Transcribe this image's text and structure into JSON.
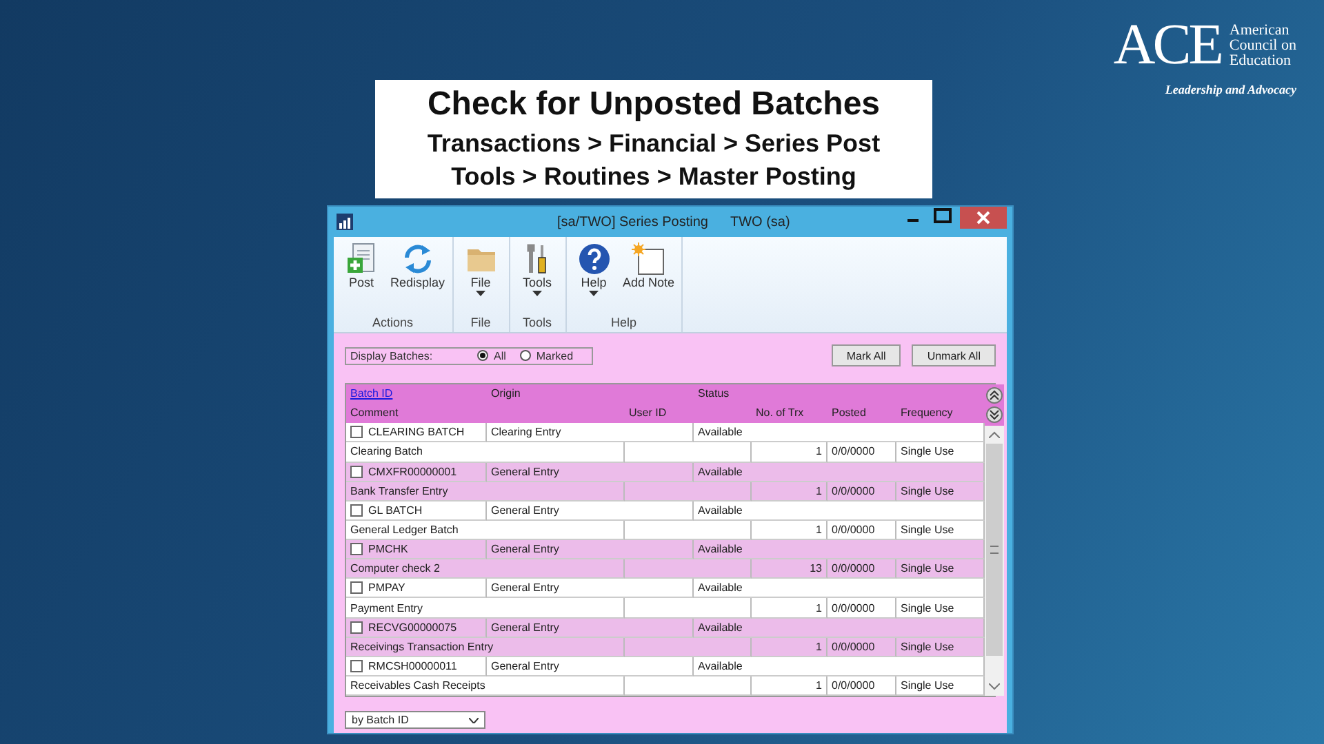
{
  "logo": {
    "wordmark": "ACE",
    "name_lines": [
      "American",
      "Council on",
      "Education"
    ],
    "tagline": "Leadership and Advocacy"
  },
  "slide": {
    "title": "Check for Unposted Batches",
    "paths": [
      "Transactions > Financial > Series Post",
      "Tools > Routines > Master Posting"
    ]
  },
  "window": {
    "title": "[sa/TWO] Series Posting",
    "company": "TWO (sa)"
  },
  "ribbon": [
    {
      "label": "Actions",
      "buttons": [
        {
          "label": "Post",
          "kind": "post",
          "dropdown": false
        },
        {
          "label": "Redisplay",
          "kind": "redisplay",
          "dropdown": false
        }
      ]
    },
    {
      "label": "File",
      "buttons": [
        {
          "label": "File",
          "kind": "folder",
          "dropdown": true
        }
      ]
    },
    {
      "label": "Tools",
      "buttons": [
        {
          "label": "Tools",
          "kind": "tools",
          "dropdown": true
        }
      ]
    },
    {
      "label": "Help",
      "buttons": [
        {
          "label": "Help",
          "kind": "help",
          "dropdown": true
        },
        {
          "label": "Add Note",
          "kind": "note",
          "dropdown": false
        }
      ]
    }
  ],
  "filter": {
    "label": "Display Batches:",
    "options": [
      {
        "label": "All",
        "selected": true
      },
      {
        "label": "Marked",
        "selected": false
      }
    ]
  },
  "buttons": [
    "Mark All",
    "Unmark All"
  ],
  "table": {
    "header_top": [
      "Batch ID",
      "Origin",
      "Status"
    ],
    "header_bottom": [
      "Comment",
      "User ID",
      "No. of Trx",
      "Posted",
      "Frequency"
    ],
    "rows": [
      {
        "batch_id": "CLEARING BATCH",
        "origin": "Clearing Entry",
        "status": "Available",
        "comment": "Clearing Batch",
        "trx": "1",
        "posted": "0/0/0000",
        "frequency": "Single Use",
        "checked": false
      },
      {
        "batch_id": "CMXFR00000001",
        "origin": "General Entry",
        "status": "Available",
        "comment": "Bank Transfer Entry",
        "trx": "1",
        "posted": "0/0/0000",
        "frequency": "Single Use",
        "checked": false
      },
      {
        "batch_id": "GL BATCH",
        "origin": "General Entry",
        "status": "Available",
        "comment": "General Ledger Batch",
        "trx": "1",
        "posted": "0/0/0000",
        "frequency": "Single Use",
        "checked": false
      },
      {
        "batch_id": "PMCHK",
        "origin": "General Entry",
        "status": "Available",
        "comment": "Computer check 2",
        "trx": "13",
        "posted": "0/0/0000",
        "frequency": "Single Use",
        "checked": false
      },
      {
        "batch_id": "PMPAY",
        "origin": "General Entry",
        "status": "Available",
        "comment": "Payment Entry",
        "trx": "1",
        "posted": "0/0/0000",
        "frequency": "Single Use",
        "checked": false
      },
      {
        "batch_id": "RECVG00000075",
        "origin": "General Entry",
        "status": "Available",
        "comment": "Receivings Transaction Entry",
        "trx": "1",
        "posted": "0/0/0000",
        "frequency": "Single Use",
        "checked": false
      },
      {
        "batch_id": "RMCSH00000011",
        "origin": "General Entry",
        "status": "Available",
        "comment": "Receivables Cash Receipts",
        "trx": "1",
        "posted": "0/0/0000",
        "frequency": "Single Use",
        "checked": false
      }
    ]
  },
  "sort": {
    "value": "by Batch ID"
  }
}
